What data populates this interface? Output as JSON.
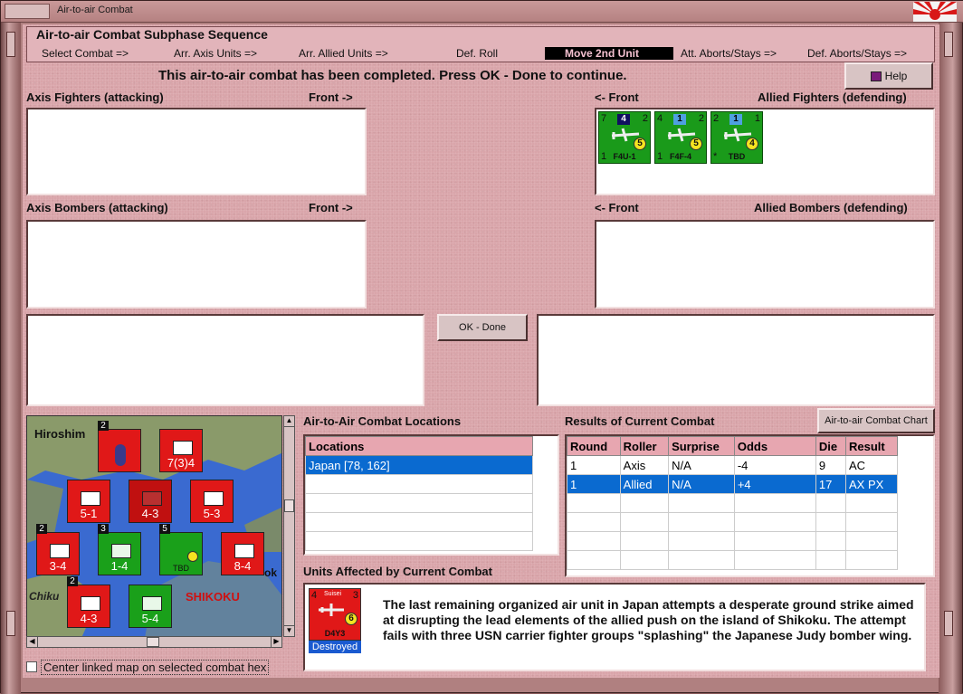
{
  "window": {
    "title": "Air-to-air Combat"
  },
  "phase": {
    "title": "Air-to-air Combat Subphase Sequence",
    "steps": [
      {
        "label": "Select Combat =>",
        "active": false
      },
      {
        "label": "Arr. Axis Units =>",
        "active": false
      },
      {
        "label": "Arr. Allied Units =>",
        "active": false
      },
      {
        "label": "Def. Roll",
        "active": false
      },
      {
        "label": "Move 2nd Unit",
        "active": true
      },
      {
        "label": "Att. Aborts/Stays =>",
        "active": false
      },
      {
        "label": "Def. Aborts/Stays =>",
        "active": false
      }
    ]
  },
  "message": "This air-to-air combat has been completed.  Press OK - Done to continue.",
  "help_button": "Help",
  "sections": {
    "axis_fighters": "Axis Fighters (attacking)",
    "axis_bombers": "Axis Bombers (attacking)",
    "allied_fighters": "Allied Fighters (defending)",
    "allied_bombers": "Allied Bombers (defending)",
    "front_right": "Front ->",
    "front_left": "<- Front"
  },
  "allied_fighters": [
    {
      "tl": "7",
      "top": "4",
      "tr": "2",
      "bl": "1",
      "circle": "5",
      "name": "F4U-1",
      "dark": true
    },
    {
      "tl": "4",
      "top": "1",
      "tr": "2",
      "bl": "1",
      "circle": "5",
      "name": "F4F-4",
      "dark": false
    },
    {
      "tl": "2",
      "top": "1",
      "tr": "1",
      "bl": "*",
      "circle": "4",
      "name": "TBD",
      "dark": false
    }
  ],
  "ok_button": "OK - Done",
  "map": {
    "labels": {
      "hiroshima": "Hiroshim",
      "shikoku": "SHIKOKU",
      "chikugo": "Chiku",
      "ok": "ok"
    },
    "units": [
      {
        "color": "red",
        "value": "",
        "badge": "2"
      },
      {
        "color": "red",
        "value": "7(3)4",
        "badge": ""
      },
      {
        "color": "red",
        "value": "5-1",
        "badge": ""
      },
      {
        "color": "red",
        "value": "4-3",
        "badge": ""
      },
      {
        "color": "red",
        "value": "5-3",
        "badge": ""
      },
      {
        "color": "red",
        "value": "3-4",
        "badge": "2"
      },
      {
        "color": "green",
        "value": "1-4",
        "badge": "3"
      },
      {
        "color": "green",
        "value": "TBD",
        "badge": "5"
      },
      {
        "color": "red",
        "value": "8-4",
        "badge": ""
      },
      {
        "color": "red",
        "value": "4-3",
        "badge": "2"
      },
      {
        "color": "green",
        "value": "5-4",
        "badge": ""
      }
    ]
  },
  "locations": {
    "title": "Air-to-Air Combat Locations",
    "header": "Locations",
    "rows": [
      "Japan [78, 162]"
    ]
  },
  "results": {
    "title": "Results of Current Combat",
    "chart_button": "Air-to-air Combat Chart",
    "headers": [
      "Round",
      "Roller",
      "Surprise",
      "Odds",
      "Die",
      "Result"
    ],
    "rows": [
      [
        "1",
        "Axis",
        "N/A",
        "-4",
        "9",
        "AC"
      ],
      [
        "1",
        "Allied",
        "N/A",
        "+4",
        "17",
        "AX PX"
      ]
    ]
  },
  "affected": {
    "title": "Units Affected by Current Combat",
    "unit": {
      "tl": "4",
      "tr": "3",
      "name": "D4Y3",
      "circle": "6",
      "status": "Destroyed",
      "top": "Suisei"
    },
    "description": "The last remaining organized air unit in Japan attempts a desperate ground strike aimed at disrupting the lead elements of the allied push on the island of Shikoku.  The attempt fails with three USN carrier fighter groups \"splashing\" the Japanese Judy bomber wing."
  },
  "center_checkbox": "Center linked map on selected combat hex"
}
